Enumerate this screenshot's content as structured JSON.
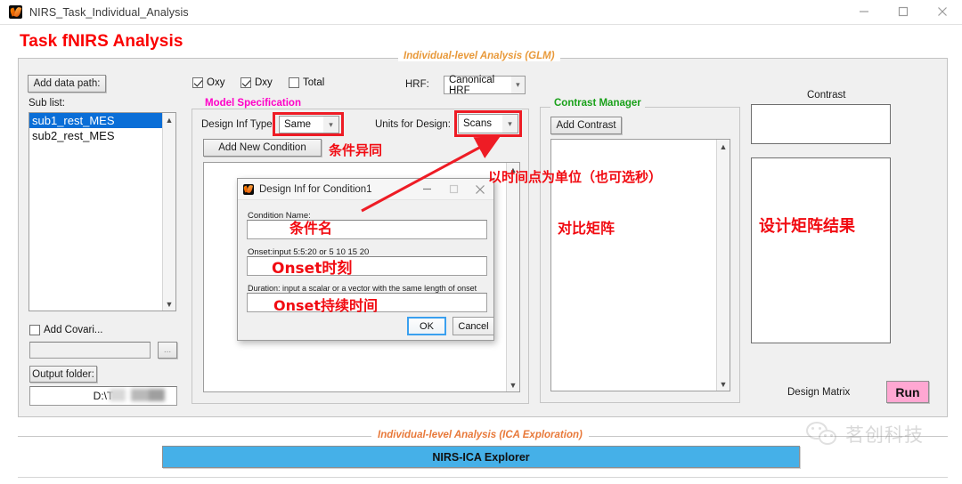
{
  "window": {
    "title": "NIRS_Task_Individual_Analysis",
    "app_icon": "matlab-icon",
    "minimize": "minimize-icon",
    "maximize": "maximize-icon",
    "close": "close-icon"
  },
  "page": {
    "heading": "Task fNIRS Analysis",
    "heading_color": "#fa0000"
  },
  "glm_panel": {
    "legend": "Individual-level Analysis (GLM)",
    "legend_color": "#e8993a"
  },
  "left": {
    "add_data_path_button": "Add data path:",
    "sub_list_label": "Sub list:",
    "sub_list_items": [
      "sub1_rest_MES",
      "sub2_rest_MES"
    ],
    "sub_list_selected_index": 0,
    "add_covariate_checkbox": "Add Covari...",
    "add_covariate_checked": false,
    "covariate_value": "",
    "covariate_browse_button": "...",
    "output_folder_button": "Output folder:",
    "output_folder_value": "D:\\T"
  },
  "signal_checkboxes": [
    {
      "label": "Oxy",
      "checked": true
    },
    {
      "label": "Dxy",
      "checked": true
    },
    {
      "label": "Total",
      "checked": false
    }
  ],
  "hrf": {
    "label": "HRF:",
    "value": "Canonical HRF",
    "chevron": "chevron-down-icon"
  },
  "model_spec": {
    "legend": "Model Specification",
    "legend_color": "#ff00c8",
    "design_inf_type_label": "Design Inf Type:",
    "design_inf_type_value": "Same",
    "units_for_design_label": "Units for Design:",
    "units_for_design_value": "Scans",
    "add_new_condition_button": "Add New Condition"
  },
  "contrast_manager": {
    "legend": "Contrast Manager",
    "legend_color": "#1aa11a",
    "add_contrast_button": "Add Contrast"
  },
  "right": {
    "contrast_label": "Contrast",
    "design_matrix_label": "Design Matrix",
    "run_button": "Run",
    "run_color": "#ffa7d2"
  },
  "dialog": {
    "title": "Design Inf for Condition1",
    "icon": "matlab-icon",
    "minimize": "minimize-icon",
    "maximize": "maximize-icon",
    "close": "close-icon",
    "condition_name_label": "Condition Name:",
    "condition_name_value": "",
    "onset_label": "Onset:input 5:5:20 or 5 10 15 20",
    "onset_value": "",
    "duration_label": "Duration: input a scalar or a vector with the same length of onset",
    "duration_value": "",
    "ok_button": "OK",
    "cancel_button": "Cancel"
  },
  "annotations": {
    "color": "#f10b12",
    "condition_diff": "条件异同",
    "units_note": "以时间点为单位（也可选秒）",
    "contrast_matrix": "对比矩阵",
    "design_matrix_result": "设计矩阵结果",
    "condition_name": "条件名",
    "onset_time": "Onset时刻",
    "onset_duration": "Onset持续时间"
  },
  "ica": {
    "legend": "Individual-level Analysis (ICA Exploration)",
    "legend_color": "#e8793a",
    "button": "NIRS-ICA Explorer",
    "button_color": "#45b0e8"
  },
  "watermark": {
    "text": "茗创科技",
    "icon": "wechat-icon"
  }
}
